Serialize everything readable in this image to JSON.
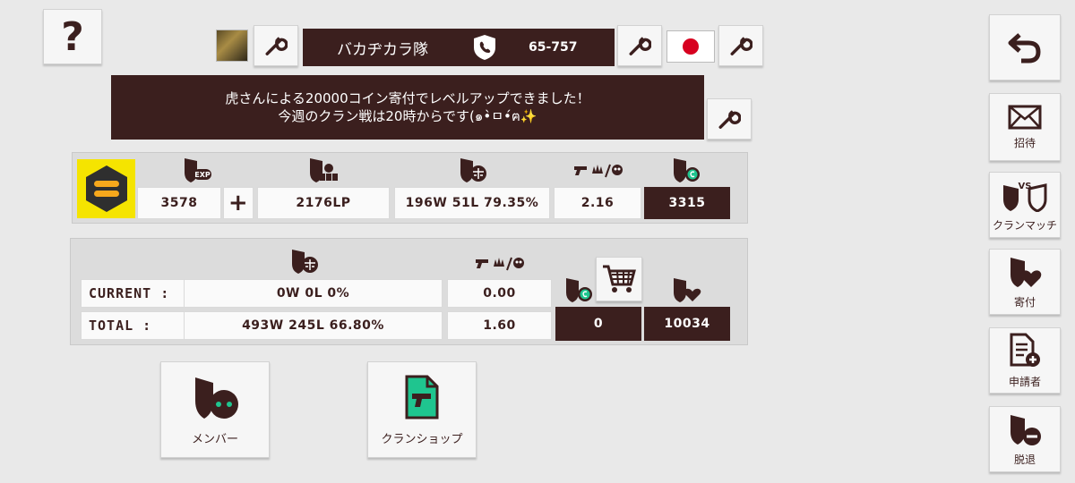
{
  "header": {
    "clan_name": "バカヂカラ隊",
    "clan_code": "65-757",
    "flag": "japan-flag"
  },
  "announcement": {
    "line1": "虎さんによる20000コイン寄付でレベルアップできました！",
    "line2": "今週のクラン戦は20時からです(๑•̀ㅁ•́ฅ✨"
  },
  "clan_stats": {
    "exp": "3578",
    "plus_label": "+",
    "league_points": "2176LP",
    "record": "196W 51L 79.35%",
    "kd": "2.16",
    "coins": "3315"
  },
  "season": {
    "current_label": "CURRENT :",
    "current_record": "0W 0L 0%",
    "current_kd": "0.00",
    "total_label": "TOTAL :",
    "total_record": "493W 245L 66.80%",
    "total_kd": "1.60",
    "coins": "0",
    "donations": "10034"
  },
  "actions": {
    "members_label": "メンバー",
    "shop_label": "クランショップ"
  },
  "sidebar": {
    "invite_label": "招待",
    "clan_match_label": "クランマッチ",
    "donate_label": "寄付",
    "applicants_label": "申請者",
    "leave_label": "脱退"
  },
  "colors": {
    "primary_dark": "#3b1f1e",
    "accent_yellow": "#f5e400",
    "accent_green": "#1fc58f",
    "flag_red": "#d7001f"
  }
}
